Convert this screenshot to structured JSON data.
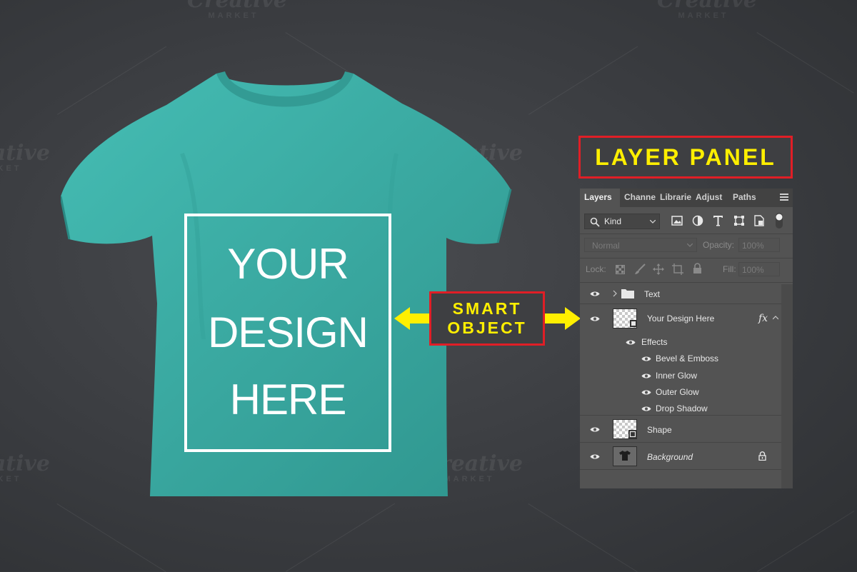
{
  "watermark": {
    "brand": "Creative",
    "sub": "MARKET"
  },
  "mockup": {
    "design_lines": [
      "YOUR",
      "DESIGN",
      "HERE"
    ],
    "shirt_color": "#3fb3ab",
    "frame_color": "#ffffff"
  },
  "callouts": {
    "layer_panel": "LAYER PANEL",
    "smart_object": [
      "SMART",
      "OBJECT"
    ],
    "accent": "#ffef00",
    "border": "#e01e26"
  },
  "panel": {
    "tabs": [
      "Layers",
      "Channe",
      "Librarie",
      "Adjust",
      "Paths"
    ],
    "active_tab": "Layers",
    "filter": {
      "kind_label": "Kind"
    },
    "blend_mode": "Normal",
    "opacity_label": "Opacity:",
    "opacity_value": "100%",
    "lock_label": "Lock:",
    "fill_label": "Fill:",
    "fill_value": "100%",
    "layers": {
      "text_group": "Text",
      "smart_layer": "Your Design Here",
      "fx_label": "fx",
      "effects_label": "Effects",
      "effects": [
        "Bevel & Emboss",
        "Inner Glow",
        "Outer Glow",
        "Drop Shadow"
      ],
      "shape_layer": "Shape",
      "background_layer": "Background"
    }
  }
}
